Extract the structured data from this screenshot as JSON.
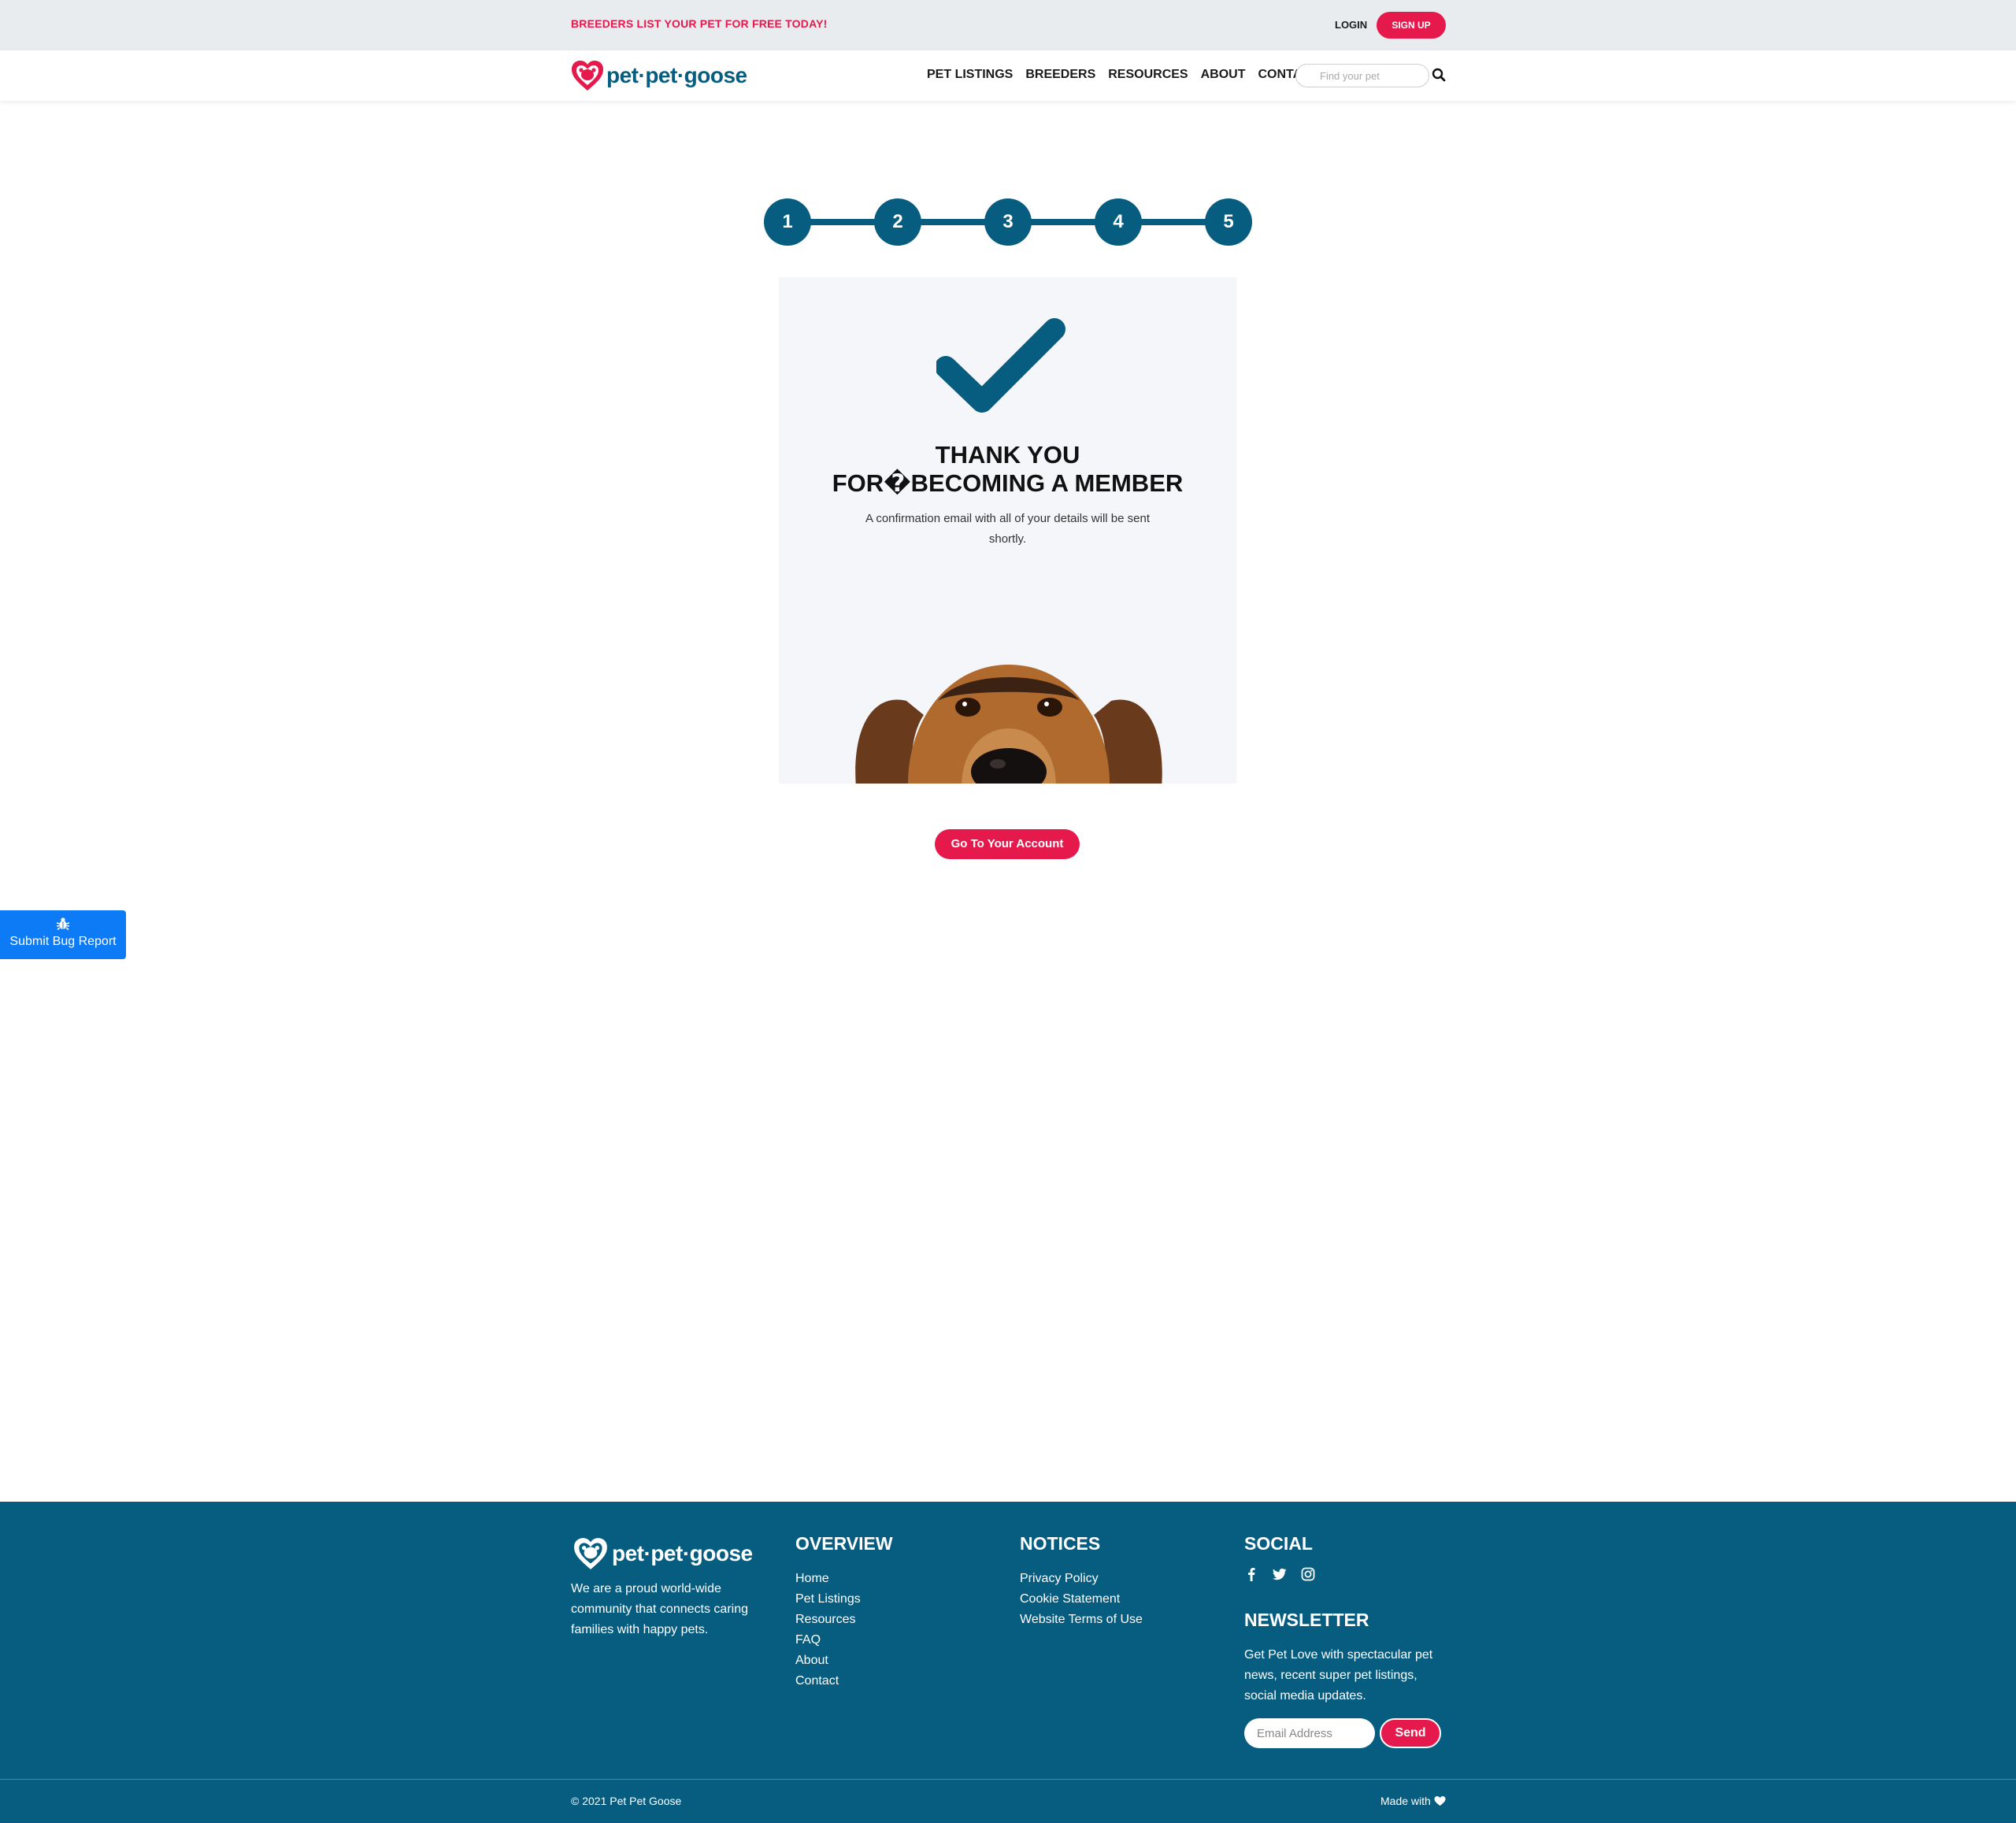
{
  "topbar": {
    "promo": "BREEDERS LIST YOUR PET FOR FREE TODAY!",
    "login": "LOGIN",
    "signup": "SIGN UP"
  },
  "header": {
    "brand": "pet·pet·goose",
    "nav": [
      "PET LISTINGS",
      "BREEDERS",
      "RESOURCES",
      "ABOUT",
      "CONTACT"
    ],
    "search_placeholder": "Find your pet"
  },
  "stepper": {
    "steps": [
      "1",
      "2",
      "3",
      "4",
      "5"
    ]
  },
  "card": {
    "title_line1": "THANK YOU",
    "title_line2": "FOR�BECOMING A MEMBER",
    "description": "A confirmation email with all of your details will be sent shortly."
  },
  "account_button": "Go To Your Account",
  "bug_report": "Submit Bug Report",
  "footer": {
    "brand": "pet·pet·goose",
    "about": "We are a proud world-wide community that connects caring families with happy pets.",
    "overview": {
      "title": "OVERVIEW",
      "links": [
        "Home",
        "Pet Listings",
        "Resources",
        "FAQ",
        "About",
        "Contact"
      ]
    },
    "notices": {
      "title": "NOTICES",
      "links": [
        "Privacy Policy",
        "Cookie Statement",
        "Website Terms of Use"
      ]
    },
    "social": {
      "title": "SOCIAL",
      "icons": [
        "facebook-icon",
        "twitter-icon",
        "instagram-icon"
      ]
    },
    "newsletter": {
      "title": "NEWSLETTER",
      "text": "Get Pet Love with spectacular pet news, recent super pet listings, social media updates.",
      "email_placeholder": "Email Address",
      "send": "Send"
    },
    "copyright": "© 2021 Pet Pet Goose",
    "made_with": "Made with"
  },
  "colors": {
    "primary": "#075d80",
    "accent": "#e5194c",
    "bug_button": "#0d7bf5",
    "topbar_bg": "#e9ecef",
    "card_bg": "#f5f6f9"
  }
}
